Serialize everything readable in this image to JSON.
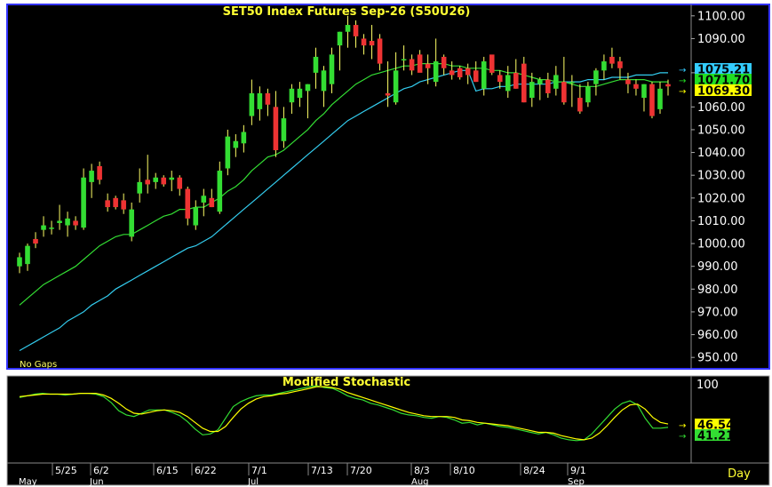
{
  "chart_data": {
    "type": "candlestick",
    "title": "SET50  Index  Futures  Sep-26  (S50U26)",
    "note": "No  Gaps",
    "period_label": "Day",
    "y_axis": {
      "ylim": [
        945,
        1105
      ],
      "ticks": [
        "1100.00",
        "1090.00",
        "1075.00",
        "1060.00",
        "1050.00",
        "1040.00",
        "1030.00",
        "1020.00",
        "1010.00",
        "1000.00",
        "990.00",
        "980.00",
        "970.00",
        "960.00",
        "950.00"
      ]
    },
    "x_axis": {
      "date_ticks": [
        "5/25",
        "6/2",
        "6/15",
        "6/22",
        "7/1",
        "7/13",
        "7/20",
        "8/3",
        "8/10",
        "8/24",
        "9/1"
      ],
      "month_labels": [
        "May",
        "Jun",
        "Jul",
        "Aug",
        "Sep"
      ]
    },
    "badges": [
      {
        "value": "1075.21",
        "color": "#33ccff",
        "text_color": "#000000"
      },
      {
        "value": "1071.70",
        "color": "#22dd22",
        "text_color": "#000000"
      },
      {
        "value": "1069.30",
        "color": "#ffff00",
        "text_color": "#000000"
      }
    ],
    "colors": {
      "up": "#33dd33",
      "down": "#ee3333",
      "wick_up": "#ffff66",
      "wick_down": "#ffff66",
      "ma_fast": "#33dd33",
      "ma_slow": "#33ccee",
      "stoch_k": "#33dd33",
      "stoch_d": "#ffff00",
      "background": "#000000",
      "grid_border": "#3333ff"
    },
    "candles": [
      {
        "o": 990,
        "h": 996,
        "l": 987,
        "c": 994
      },
      {
        "o": 991,
        "h": 1000,
        "l": 988,
        "c": 999
      },
      {
        "o": 1002,
        "h": 1005,
        "l": 998,
        "c": 1000
      },
      {
        "o": 1006,
        "h": 1012,
        "l": 1003,
        "c": 1008
      },
      {
        "o": 1007,
        "h": 1010,
        "l": 1004,
        "c": 1007
      },
      {
        "o": 1009,
        "h": 1017,
        "l": 1006,
        "c": 1010
      },
      {
        "o": 1008,
        "h": 1014,
        "l": 1003,
        "c": 1011
      },
      {
        "o": 1010,
        "h": 1012,
        "l": 1006,
        "c": 1008
      },
      {
        "o": 1007,
        "h": 1033,
        "l": 1006,
        "c": 1029
      },
      {
        "o": 1027,
        "h": 1035,
        "l": 1020,
        "c": 1032
      },
      {
        "o": 1034,
        "h": 1036,
        "l": 1026,
        "c": 1028
      },
      {
        "o": 1019,
        "h": 1022,
        "l": 1014,
        "c": 1016
      },
      {
        "o": 1020,
        "h": 1021,
        "l": 1015,
        "c": 1016
      },
      {
        "o": 1019,
        "h": 1022,
        "l": 1013,
        "c": 1015
      },
      {
        "o": 1003,
        "h": 1018,
        "l": 1001,
        "c": 1015
      },
      {
        "o": 1022,
        "h": 1033,
        "l": 1018,
        "c": 1027
      },
      {
        "o": 1028,
        "h": 1039,
        "l": 1022,
        "c": 1026
      },
      {
        "o": 1027,
        "h": 1031,
        "l": 1024,
        "c": 1029
      },
      {
        "o": 1029,
        "h": 1030,
        "l": 1025,
        "c": 1026
      },
      {
        "o": 1028,
        "h": 1032,
        "l": 1023,
        "c": 1029
      },
      {
        "o": 1029,
        "h": 1030,
        "l": 1021,
        "c": 1024
      },
      {
        "o": 1024,
        "h": 1025,
        "l": 1008,
        "c": 1011
      },
      {
        "o": 1008,
        "h": 1019,
        "l": 1006,
        "c": 1016
      },
      {
        "o": 1018,
        "h": 1024,
        "l": 1012,
        "c": 1021
      },
      {
        "o": 1020,
        "h": 1024,
        "l": 1016,
        "c": 1016
      },
      {
        "o": 1014,
        "h": 1036,
        "l": 1013,
        "c": 1032
      },
      {
        "o": 1033,
        "h": 1050,
        "l": 1030,
        "c": 1047
      },
      {
        "o": 1042,
        "h": 1048,
        "l": 1038,
        "c": 1045
      },
      {
        "o": 1044,
        "h": 1052,
        "l": 1040,
        "c": 1049
      },
      {
        "o": 1056,
        "h": 1072,
        "l": 1052,
        "c": 1066
      },
      {
        "o": 1059,
        "h": 1069,
        "l": 1054,
        "c": 1066
      },
      {
        "o": 1066,
        "h": 1068,
        "l": 1056,
        "c": 1061
      },
      {
        "o": 1060,
        "h": 1067,
        "l": 1038,
        "c": 1041
      },
      {
        "o": 1045,
        "h": 1060,
        "l": 1042,
        "c": 1055
      },
      {
        "o": 1062,
        "h": 1070,
        "l": 1057,
        "c": 1068
      },
      {
        "o": 1064,
        "h": 1071,
        "l": 1060,
        "c": 1068
      },
      {
        "o": 1067,
        "h": 1070,
        "l": 1055,
        "c": 1070
      },
      {
        "o": 1075,
        "h": 1086,
        "l": 1068,
        "c": 1082
      },
      {
        "o": 1067,
        "h": 1078,
        "l": 1060,
        "c": 1076
      },
      {
        "o": 1070,
        "h": 1086,
        "l": 1066,
        "c": 1083
      },
      {
        "o": 1087,
        "h": 1093,
        "l": 1076,
        "c": 1093
      },
      {
        "o": 1093,
        "h": 1100,
        "l": 1086,
        "c": 1096
      },
      {
        "o": 1096,
        "h": 1098,
        "l": 1086,
        "c": 1091
      },
      {
        "o": 1090,
        "h": 1092,
        "l": 1083,
        "c": 1087
      },
      {
        "o": 1089,
        "h": 1096,
        "l": 1081,
        "c": 1087
      },
      {
        "o": 1090,
        "h": 1092,
        "l": 1076,
        "c": 1079
      },
      {
        "o": 1066,
        "h": 1080,
        "l": 1060,
        "c": 1065
      },
      {
        "o": 1062,
        "h": 1084,
        "l": 1061,
        "c": 1076
      },
      {
        "o": 1081,
        "h": 1087,
        "l": 1076,
        "c": 1081
      },
      {
        "o": 1081,
        "h": 1083,
        "l": 1074,
        "c": 1076
      },
      {
        "o": 1083,
        "h": 1085,
        "l": 1076,
        "c": 1075
      },
      {
        "o": 1079,
        "h": 1083,
        "l": 1070,
        "c": 1077
      },
      {
        "o": 1071,
        "h": 1090,
        "l": 1069,
        "c": 1080
      },
      {
        "o": 1082,
        "h": 1083,
        "l": 1074,
        "c": 1077
      },
      {
        "o": 1076,
        "h": 1080,
        "l": 1072,
        "c": 1074
      },
      {
        "o": 1077,
        "h": 1078,
        "l": 1072,
        "c": 1073
      },
      {
        "o": 1077,
        "h": 1079,
        "l": 1070,
        "c": 1074
      },
      {
        "o": 1076,
        "h": 1080,
        "l": 1071,
        "c": 1071
      },
      {
        "o": 1068,
        "h": 1082,
        "l": 1065,
        "c": 1080
      },
      {
        "o": 1083,
        "h": 1082,
        "l": 1074,
        "c": 1075
      },
      {
        "o": 1074,
        "h": 1076,
        "l": 1068,
        "c": 1071
      },
      {
        "o": 1067,
        "h": 1078,
        "l": 1064,
        "c": 1074
      },
      {
        "o": 1075,
        "h": 1081,
        "l": 1068,
        "c": 1068
      },
      {
        "o": 1079,
        "h": 1082,
        "l": 1062,
        "c": 1062
      },
      {
        "o": 1064,
        "h": 1075,
        "l": 1060,
        "c": 1071
      },
      {
        "o": 1070,
        "h": 1073,
        "l": 1063,
        "c": 1072
      },
      {
        "o": 1072,
        "h": 1075,
        "l": 1064,
        "c": 1066
      },
      {
        "o": 1068,
        "h": 1078,
        "l": 1065,
        "c": 1074
      },
      {
        "o": 1071,
        "h": 1082,
        "l": 1061,
        "c": 1062
      },
      {
        "o": 1071,
        "h": 1074,
        "l": 1060,
        "c": 1071
      },
      {
        "o": 1064,
        "h": 1070,
        "l": 1057,
        "c": 1058
      },
      {
        "o": 1062,
        "h": 1071,
        "l": 1060,
        "c": 1069
      },
      {
        "o": 1070,
        "h": 1077,
        "l": 1065,
        "c": 1076
      },
      {
        "o": 1076,
        "h": 1083,
        "l": 1072,
        "c": 1080
      },
      {
        "o": 1082,
        "h": 1086,
        "l": 1077,
        "c": 1079
      },
      {
        "o": 1080,
        "h": 1082,
        "l": 1072,
        "c": 1077
      },
      {
        "o": 1072,
        "h": 1075,
        "l": 1066,
        "c": 1070
      },
      {
        "o": 1070,
        "h": 1072,
        "l": 1065,
        "c": 1068
      },
      {
        "o": 1064,
        "h": 1070,
        "l": 1058,
        "c": 1070
      },
      {
        "o": 1070,
        "h": 1071,
        "l": 1055,
        "c": 1056
      },
      {
        "o": 1059,
        "h": 1071,
        "l": 1057,
        "c": 1068
      },
      {
        "o": 1070,
        "h": 1072,
        "l": 1065,
        "c": 1069
      }
    ],
    "ma_fast": [
      973,
      976,
      979,
      982,
      984,
      986,
      988,
      990,
      993,
      996,
      999,
      1001,
      1003,
      1004,
      1004,
      1006,
      1008,
      1010,
      1012,
      1013,
      1015,
      1015,
      1016,
      1016,
      1018,
      1020,
      1023,
      1025,
      1028,
      1032,
      1035,
      1038,
      1039,
      1041,
      1044,
      1047,
      1050,
      1054,
      1057,
      1061,
      1064,
      1067,
      1070,
      1072,
      1074,
      1075,
      1076,
      1077,
      1078,
      1078,
      1079,
      1079,
      1079,
      1079,
      1078,
      1078,
      1077,
      1077,
      1077,
      1076,
      1076,
      1075,
      1075,
      1074,
      1073,
      1072,
      1072,
      1071,
      1071,
      1070,
      1069,
      1069,
      1069,
      1070,
      1071,
      1072,
      1072,
      1072,
      1072,
      1071,
      1071,
      1071
    ],
    "ma_slow": [
      953,
      955,
      957,
      959,
      961,
      963,
      966,
      968,
      970,
      973,
      975,
      977,
      980,
      982,
      984,
      986,
      988,
      990,
      992,
      994,
      996,
      998,
      999,
      1001,
      1003,
      1006,
      1009,
      1012,
      1015,
      1018,
      1021,
      1024,
      1027,
      1030,
      1033,
      1036,
      1039,
      1042,
      1045,
      1048,
      1051,
      1054,
      1056,
      1058,
      1060,
      1062,
      1064,
      1066,
      1068,
      1069,
      1071,
      1072,
      1073,
      1074,
      1075,
      1076,
      1076,
      1067,
      1068,
      1068,
      1069,
      1069,
      1070,
      1070,
      1070,
      1070,
      1070,
      1071,
      1071,
      1071,
      1071,
      1072,
      1072,
      1072,
      1073,
      1073,
      1073,
      1074,
      1074,
      1074,
      1075,
      1075
    ],
    "stochastic": {
      "title": "Modified  Stochastic",
      "ylim": [
        0,
        105
      ],
      "tick": "100",
      "k_label": "41.21",
      "d_label": "46.54",
      "k": [
        79,
        81,
        83,
        84,
        83,
        83,
        82,
        83,
        84,
        84,
        83,
        80,
        73,
        63,
        58,
        56,
        60,
        64,
        64,
        64,
        61,
        57,
        50,
        41,
        34,
        35,
        40,
        54,
        68,
        74,
        78,
        81,
        82,
        82,
        84,
        86,
        88,
        90,
        92,
        93,
        91,
        90,
        86,
        81,
        78,
        76,
        72,
        70,
        67,
        64,
        60,
        58,
        57,
        55,
        54,
        56,
        55,
        52,
        48,
        49,
        46,
        48,
        46,
        44,
        43,
        41,
        39,
        37,
        35,
        37,
        34,
        30,
        28,
        27,
        28,
        35,
        45,
        55,
        65,
        72,
        75,
        70,
        54,
        42,
        42,
        43
      ],
      "d": [
        80,
        81,
        82,
        83,
        83,
        83,
        83,
        83,
        84,
        84,
        84,
        82,
        78,
        72,
        65,
        60,
        59,
        61,
        63,
        64,
        63,
        61,
        56,
        49,
        42,
        38,
        38,
        44,
        55,
        65,
        72,
        77,
        80,
        81,
        83,
        84,
        86,
        88,
        90,
        92,
        92,
        91,
        89,
        85,
        82,
        79,
        76,
        73,
        70,
        67,
        64,
        61,
        59,
        57,
        56,
        56,
        56,
        55,
        52,
        51,
        49,
        48,
        47,
        46,
        45,
        43,
        41,
        39,
        37,
        37,
        36,
        33,
        31,
        29,
        28,
        30,
        36,
        45,
        55,
        64,
        70,
        71,
        65,
        55,
        49,
        47
      ]
    }
  }
}
